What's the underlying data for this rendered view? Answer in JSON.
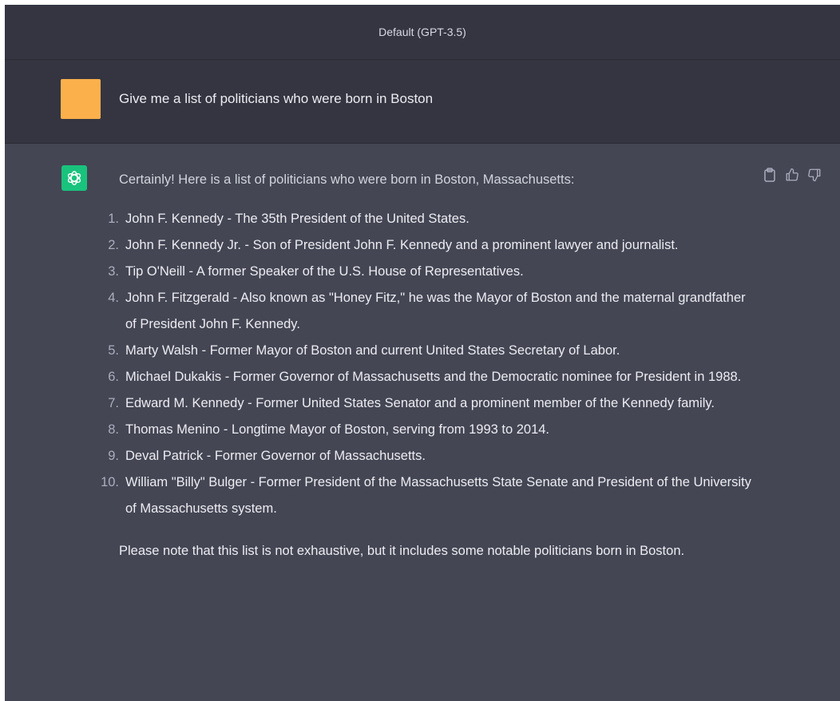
{
  "header": {
    "model_label": "Default (GPT-3.5)"
  },
  "user_message": {
    "text": "Give me a list of politicians who were born in Boston"
  },
  "assistant_message": {
    "intro": "Certainly! Here is a list of politicians who were born in Boston, Massachusetts:",
    "items": [
      {
        "num": "1.",
        "text": "John F. Kennedy - The 35th President of the United States."
      },
      {
        "num": "2.",
        "text": "John F. Kennedy Jr. - Son of President John F. Kennedy and a prominent lawyer and journalist."
      },
      {
        "num": "3.",
        "text": "Tip O'Neill - A former Speaker of the U.S. House of Representatives."
      },
      {
        "num": "4.",
        "text": "John F. Fitzgerald - Also known as \"Honey Fitz,\" he was the Mayor of Boston and the maternal grandfather of President John F. Kennedy."
      },
      {
        "num": "5.",
        "text": "Marty Walsh - Former Mayor of Boston and current United States Secretary of Labor."
      },
      {
        "num": "6.",
        "text": "Michael Dukakis - Former Governor of Massachusetts and the Democratic nominee for President in 1988."
      },
      {
        "num": "7.",
        "text": "Edward M. Kennedy - Former United States Senator and a prominent member of the Kennedy family."
      },
      {
        "num": "8.",
        "text": "Thomas Menino - Longtime Mayor of Boston, serving from 1993 to 2014."
      },
      {
        "num": "9.",
        "text": "Deval Patrick - Former Governor of Massachusetts."
      },
      {
        "num": "10.",
        "text": "William \"Billy\" Bulger - Former President of the Massachusetts State Senate and President of the University of Massachusetts system."
      }
    ],
    "note": "Please note that this list is not exhaustive, but it includes some notable politicians born in Boston."
  },
  "actions": {
    "copy_icon": "clipboard-icon",
    "like_icon": "thumbs-up-icon",
    "dislike_icon": "thumbs-down-icon"
  },
  "colors": {
    "user_avatar": "#fbb04b",
    "assistant_avatar": "#19c37d",
    "header_bg": "#343541",
    "assistant_bg": "#444654"
  }
}
